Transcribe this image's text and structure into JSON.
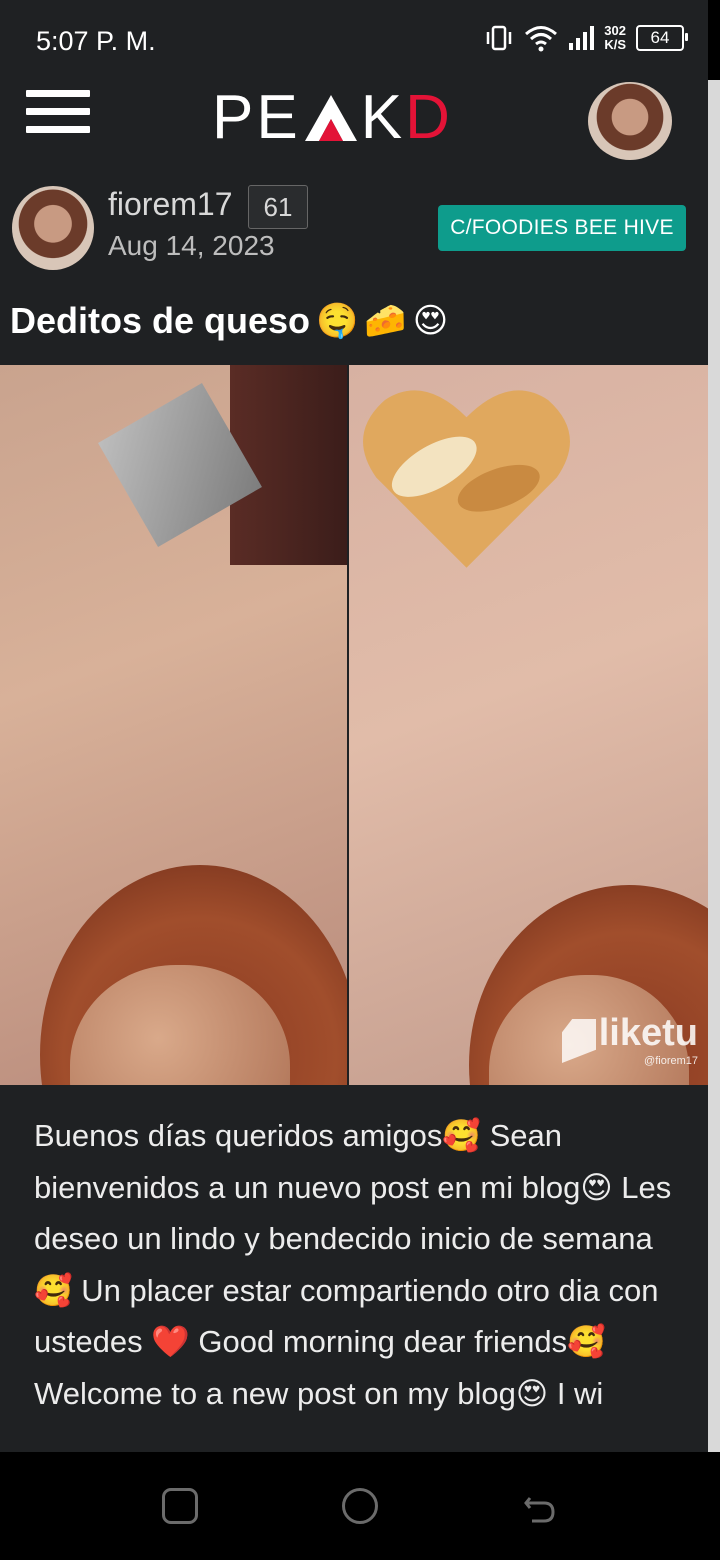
{
  "status_bar": {
    "time": "5:07 P. M.",
    "speed_value": "302",
    "speed_unit": "K/S",
    "battery": "64"
  },
  "header": {
    "logo_left": "PE",
    "logo_right": "K",
    "logo_end": "D",
    "brand_color": "#e31337"
  },
  "post": {
    "author": "fiorem17",
    "reputation": "61",
    "date": "Aug 14, 2023",
    "community": "C/FOODIES BEE HIVE",
    "community_color": "#0e9c8c",
    "title": "Deditos de queso",
    "title_emojis": [
      "🤤",
      "🧀",
      "😍"
    ],
    "image_watermark": "liketu",
    "image_watermark_handle": "@fiorem17",
    "body": "Buenos días queridos amigos🥰 Sean bienvenidos a un nuevo post en mi blog😍 Les deseo un lindo y bendecido inicio de semana🥰 Un placer estar compartiendo otro dia con ustedes ❤️ Good morning dear friends🥰 Welcome to a new post on my blog😍 I wi"
  },
  "navbar": {
    "icons": [
      "recent-apps-icon",
      "home-icon",
      "back-icon"
    ]
  }
}
